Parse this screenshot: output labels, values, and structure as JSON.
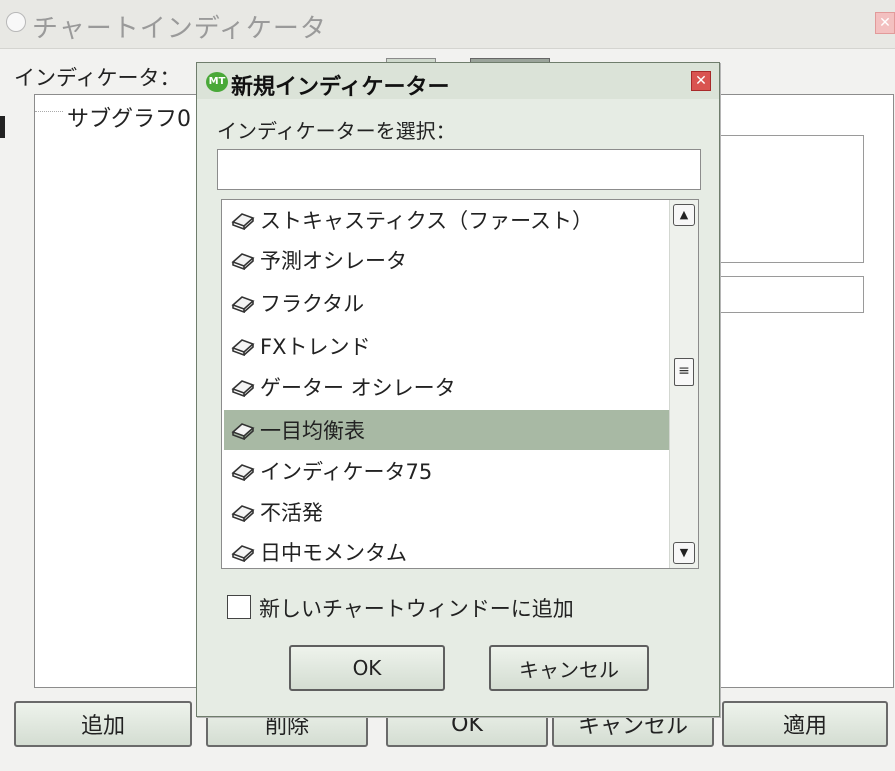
{
  "parent": {
    "title": "チャートインディケータ",
    "indicator_label": "インディケータ：",
    "tree_item": "サブグラフ0",
    "buttons": {
      "add": "追加",
      "delete": "削除",
      "ok": "OK",
      "cancel": "キャンセル",
      "apply": "適用"
    }
  },
  "dialog": {
    "title": "新規インディケーター",
    "select_label": "インディケーターを選択：",
    "search_value": "",
    "items": [
      "ストキャスティクス（ファースト）",
      "予測オシレータ",
      "フラクタル",
      "FXトレンド",
      "ゲーター オシレータ",
      "一目均衡表",
      "インディケータ75",
      "不活発",
      "日中モメンタム"
    ],
    "selected_item": "一目均衡表",
    "checkbox_label": "新しいチャートウィンドーに追加",
    "checkbox_checked": false,
    "ok_label": "OK",
    "cancel_label": "キャンセル"
  },
  "colors": {
    "selection": "#a8b9a4",
    "dialog_bg": "#e6ece4",
    "button_top": "#eef3ec",
    "button_bottom": "#d4ddd2",
    "close_red": "#d95450",
    "app_icon_green": "#49a838"
  },
  "icons": {
    "list_item_icon": "indicator-icon",
    "scroll_up": "scroll-up-icon",
    "scroll_down": "scroll-down-icon"
  }
}
